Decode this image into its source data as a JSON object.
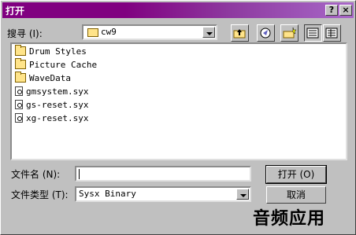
{
  "window": {
    "title": "打开",
    "help_btn": "?",
    "close_btn": "×"
  },
  "toolbar": {
    "lookin_label": "搜寻 (I):",
    "lookin_value": "cw9"
  },
  "files": [
    {
      "name": "Drum Styles",
      "type": "folder"
    },
    {
      "name": "Picture Cache",
      "type": "folder"
    },
    {
      "name": "WaveData",
      "type": "folder"
    },
    {
      "name": "gmsystem.syx",
      "type": "file"
    },
    {
      "name": "gs-reset.syx",
      "type": "file"
    },
    {
      "name": "xg-reset.syx",
      "type": "file"
    }
  ],
  "form": {
    "filename_label": "文件名 (N):",
    "filename_value": "",
    "filetype_label": "文件类型 (T):",
    "filetype_value": "Sysx Binary"
  },
  "buttons": {
    "open": "打开 (O)",
    "cancel": "取消"
  },
  "watermark": "音频应用"
}
